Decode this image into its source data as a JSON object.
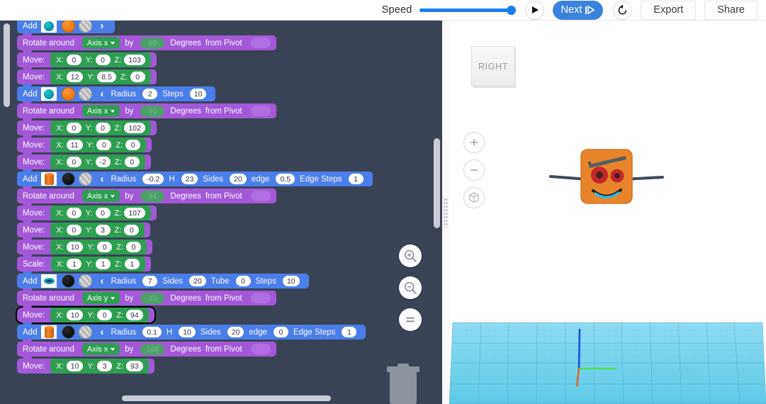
{
  "toolbar": {
    "speed_label": "Speed",
    "speed_value": 100,
    "play_icon": "play-icon",
    "next_label": "Next",
    "next_icon": "step-forward-icon",
    "reset_icon": "reset-rotate-icon",
    "export_label": "Export",
    "share_label": "Share"
  },
  "editor": {
    "side_controls": [
      {
        "name": "zoom-in",
        "icon": "magnifier-plus-icon"
      },
      {
        "name": "zoom-out",
        "icon": "magnifier-minus-icon"
      },
      {
        "name": "zoom-fit",
        "icon": "equals-icon"
      }
    ],
    "trash_icon": "trash-icon",
    "blocks": [
      {
        "type": "add",
        "label": "Add",
        "shape": "sphere",
        "material": "orange",
        "texture": "striped",
        "chevron": "›",
        "params": [],
        "cut_off_top": true
      },
      {
        "type": "rotate",
        "label": "Rotate around",
        "axis": "Axis x",
        "by": "by",
        "degrees": "90",
        "deg_label": "Degrees",
        "pivot_label": "from Pivot"
      },
      {
        "type": "move",
        "label": "Move:",
        "x": "0",
        "y": "0",
        "z": "103"
      },
      {
        "type": "move",
        "label": "Move:",
        "x": "12",
        "y": "8.5",
        "z": "0"
      },
      {
        "type": "add",
        "label": "Add",
        "shape": "sphere",
        "material": "orange",
        "texture": "striped",
        "chevron": "‹",
        "params": [
          {
            "label": "Radius",
            "value": "2"
          },
          {
            "label": "Steps",
            "value": "10"
          }
        ]
      },
      {
        "type": "rotate",
        "label": "Rotate around",
        "axis": "Axis x",
        "by": "by",
        "degrees": "90",
        "deg_label": "Degrees",
        "pivot_label": "from Pivot"
      },
      {
        "type": "move",
        "label": "Move:",
        "x": "0",
        "y": "0",
        "z": "102"
      },
      {
        "type": "move",
        "label": "Move:",
        "x": "11",
        "y": "0",
        "z": "0"
      },
      {
        "type": "move",
        "label": "Move:",
        "x": "0",
        "y": "-2",
        "z": "0"
      },
      {
        "type": "add",
        "label": "Add",
        "shape": "cylinder",
        "material": "black",
        "texture": "striped",
        "chevron": "‹",
        "params": [
          {
            "label": "Radius",
            "value": "-0.2"
          },
          {
            "label": "H",
            "value": "23"
          },
          {
            "label": "Sides",
            "value": "20"
          },
          {
            "label": "edge",
            "value": "0.5"
          },
          {
            "label": "Edge Steps",
            "value": "1"
          }
        ]
      },
      {
        "type": "rotate",
        "label": "Rotate around",
        "axis": "Axis x",
        "by": "by",
        "degrees": "94",
        "deg_label": "Degrees",
        "pivot_label": "from Pivot"
      },
      {
        "type": "move",
        "label": "Move:",
        "x": "0",
        "y": "0",
        "z": "107"
      },
      {
        "type": "move",
        "label": "Move:",
        "x": "0",
        "y": "3",
        "z": "0"
      },
      {
        "type": "move",
        "label": "Move:",
        "x": "10",
        "y": "0",
        "z": "0"
      },
      {
        "type": "scale",
        "label": "Scale:",
        "x": "1",
        "y": "1",
        "z": "1"
      },
      {
        "type": "add",
        "label": "Add",
        "shape": "torus",
        "material": "black",
        "texture": "striped",
        "chevron": "‹",
        "params": [
          {
            "label": "Radius",
            "value": "7"
          },
          {
            "label": "Sides",
            "value": "20"
          },
          {
            "label": "Tube",
            "value": "0"
          },
          {
            "label": "Steps",
            "value": "10"
          }
        ]
      },
      {
        "type": "rotate",
        "label": "Rotate around",
        "axis": "Axis y",
        "by": "by",
        "degrees": "15",
        "deg_label": "Degrees",
        "pivot_label": "from Pivot"
      },
      {
        "type": "move",
        "label": "Move:",
        "x": "10",
        "y": "0",
        "z": "94",
        "selected": true
      },
      {
        "type": "add",
        "label": "Add",
        "shape": "cylinder",
        "material": "black",
        "texture": "striped",
        "chevron": "‹",
        "params": [
          {
            "label": "Radius",
            "value": "0.1"
          },
          {
            "label": "H",
            "value": "10"
          },
          {
            "label": "Sides",
            "value": "20"
          },
          {
            "label": "edge",
            "value": "0"
          },
          {
            "label": "Edge Steps",
            "value": "1"
          }
        ]
      },
      {
        "type": "rotate",
        "label": "Rotate around",
        "axis": "Axis x",
        "by": "by",
        "degrees": "106",
        "deg_label": "Degrees",
        "pivot_label": "from Pivot"
      },
      {
        "type": "move",
        "label": "Move:",
        "x": "10",
        "y": "3",
        "z": "93"
      }
    ]
  },
  "viewport": {
    "view_cube_label": "RIGHT",
    "controls": [
      {
        "name": "zoom-in",
        "icon": "plus-icon"
      },
      {
        "name": "zoom-out",
        "icon": "minus-icon"
      },
      {
        "name": "home-view",
        "icon": "cube-home-icon"
      }
    ],
    "model_name": "robot-head-model",
    "ground_name": "grid-floor"
  },
  "colors": {
    "accent_blue": "#3b82e0",
    "editor_bg": "#3a4356",
    "block_add": "#4a7ee8",
    "block_transform": "#a358d8",
    "param_green": "#2e9e52",
    "grid_blue": "#6fd0ec",
    "model_orange": "#e8842a"
  }
}
